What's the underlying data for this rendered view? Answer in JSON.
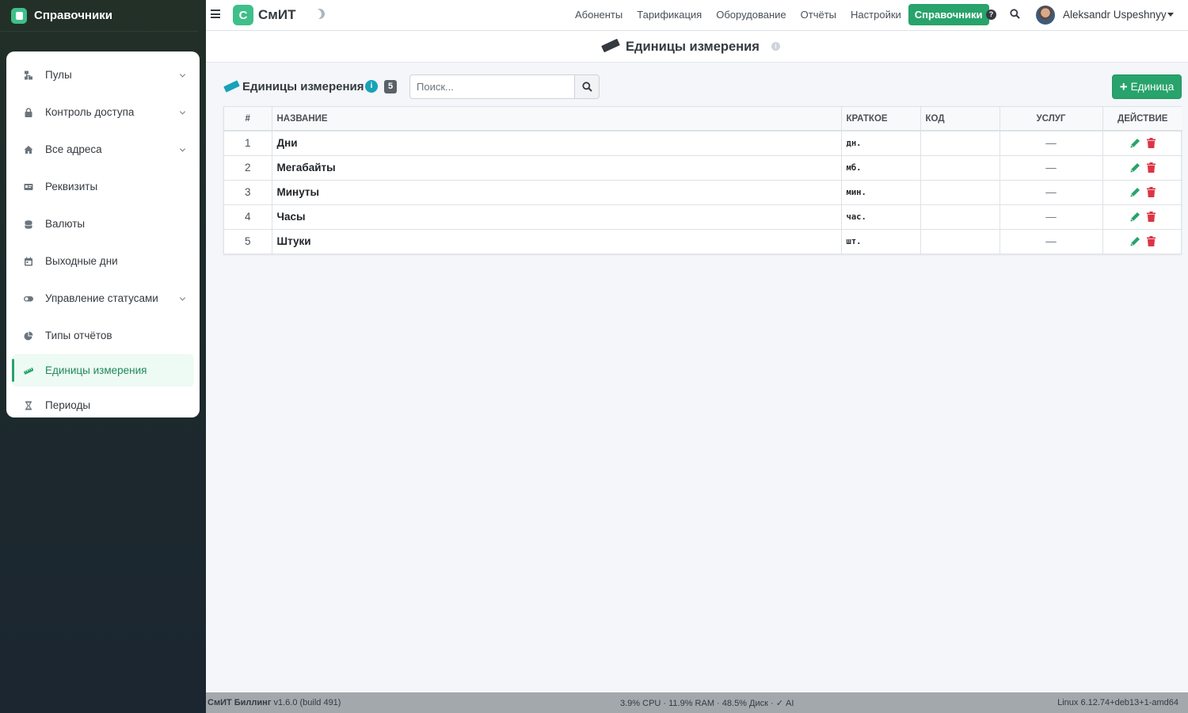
{
  "app": {
    "section_title": "Справочники",
    "logo_letter": "С",
    "logo_text": "СмИТ"
  },
  "sidebar": {
    "items": [
      {
        "label": "Пулы",
        "icon": "network-icon",
        "has_submenu": true
      },
      {
        "label": "Контроль доступа",
        "icon": "lock-icon",
        "has_submenu": true
      },
      {
        "label": "Все адреса",
        "icon": "home-icon",
        "has_submenu": true
      },
      {
        "label": "Реквизиты",
        "icon": "id-card-icon",
        "has_submenu": false
      },
      {
        "label": "Валюты",
        "icon": "coins-icon",
        "has_submenu": false
      },
      {
        "label": "Выходные дни",
        "icon": "calendar-icon",
        "has_submenu": false
      },
      {
        "label": "Управление статусами",
        "icon": "toggle-icon",
        "has_submenu": true
      },
      {
        "label": "Типы отчётов",
        "icon": "pie-chart-icon",
        "has_submenu": false
      },
      {
        "label": "Единицы измерения",
        "icon": "ruler-icon",
        "has_submenu": false,
        "active": true
      },
      {
        "label": "Периоды",
        "icon": "hourglass-icon",
        "has_submenu": false
      }
    ]
  },
  "topnav": {
    "links": [
      "Абоненты",
      "Тарификация",
      "Оборудование",
      "Отчёты",
      "Настройки"
    ],
    "active": "Справочники",
    "user": "Aleksandr Uspeshnyy"
  },
  "page": {
    "title": "Единицы измерения"
  },
  "toolbar": {
    "title": "Единицы измерения",
    "count": "5",
    "search_placeholder": "Поиск...",
    "add_label": "Единица"
  },
  "table": {
    "headers": {
      "num": "#",
      "name": "НАЗВАНИЕ",
      "short": "КРАТКОЕ",
      "code": "КОД",
      "services": "УСЛУГ",
      "actions": "ДЕЙСТВИЕ"
    },
    "rows": [
      {
        "num": "1",
        "name": "Дни",
        "short": "дн.",
        "code": "",
        "services": "—"
      },
      {
        "num": "2",
        "name": "Мегабайты",
        "short": "мб.",
        "code": "",
        "services": "—"
      },
      {
        "num": "3",
        "name": "Минуты",
        "short": "мин.",
        "code": "",
        "services": "—"
      },
      {
        "num": "4",
        "name": "Часы",
        "short": "час.",
        "code": "",
        "services": "—"
      },
      {
        "num": "5",
        "name": "Штуки",
        "short": "шт.",
        "code": "",
        "services": "—"
      }
    ]
  },
  "footer": {
    "product": "СмИТ Биллинг",
    "version": "v1.6.0 (build 491)",
    "stats": "3.9% CPU · 11.9% RAM · 48.5% Диск · ✓ AI",
    "os": "Linux 6.12.74+deb13+1-amd64"
  },
  "colors": {
    "accent": "#28a36b",
    "danger": "#dc3545",
    "info": "#17a2b8"
  }
}
